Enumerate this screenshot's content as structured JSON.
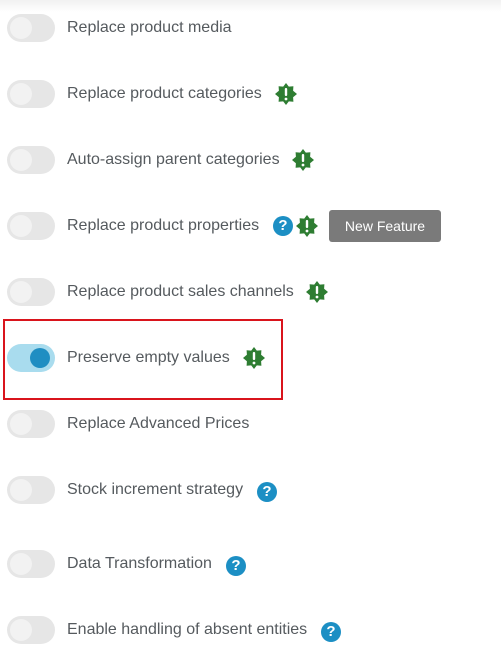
{
  "options": [
    {
      "label": "Replace product media",
      "enabled": false,
      "icons": []
    },
    {
      "label": "Replace product categories",
      "enabled": false,
      "icons": [
        "warning-badge-icon"
      ]
    },
    {
      "label": "Auto-assign parent categories",
      "enabled": false,
      "icons": [
        "warning-badge-icon"
      ]
    },
    {
      "label": "Replace product properties",
      "enabled": false,
      "icons": [
        "help-icon",
        "warning-badge-icon"
      ],
      "badge": "New Feature"
    },
    {
      "label": "Replace product sales channels",
      "enabled": false,
      "icons": [
        "warning-badge-icon"
      ]
    },
    {
      "label": "Preserve empty values",
      "enabled": true,
      "icons": [
        "warning-badge-icon"
      ],
      "highlighted": true
    },
    {
      "label": "Replace Advanced Prices",
      "enabled": false,
      "icons": []
    },
    {
      "label": "Stock increment strategy",
      "enabled": false,
      "icons": [
        "help-icon"
      ]
    },
    {
      "label": "Data Transformation",
      "enabled": false,
      "icons": [
        "help-icon"
      ]
    },
    {
      "label": "Enable handling of absent entities",
      "enabled": false,
      "icons": [
        "help-icon"
      ]
    }
  ],
  "help_glyph": "?",
  "colors": {
    "toggle_on_track": "#a9dcee",
    "toggle_on_knob": "#1f8ec2",
    "toggle_off_track": "#e6e6e6",
    "help": "#1c8fc4",
    "warning_badge": "#2e7d32",
    "highlight_border": "#d9141c",
    "new_feature_badge": "#7a7a7a"
  }
}
